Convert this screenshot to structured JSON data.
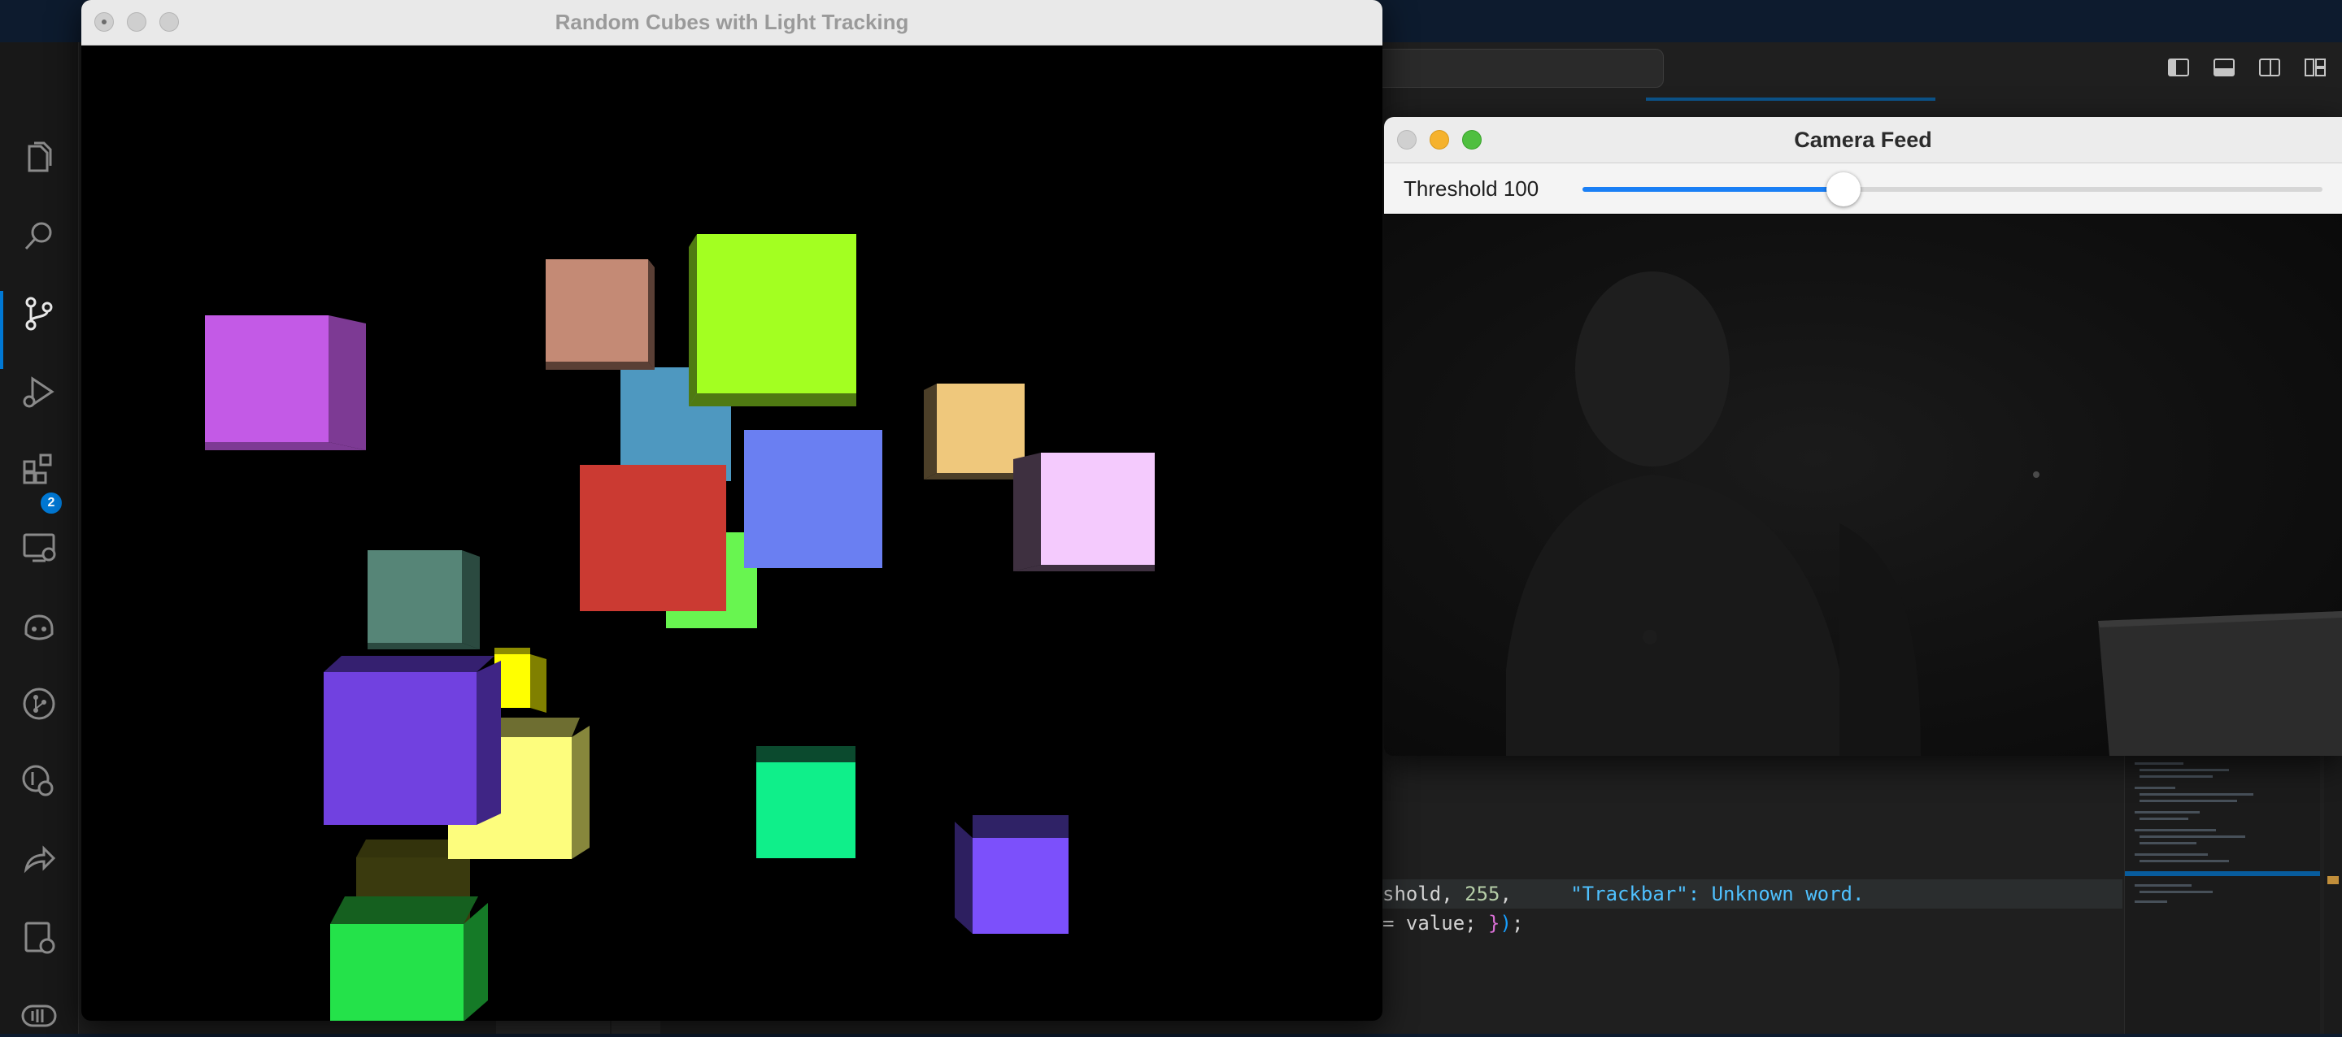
{
  "vscode": {
    "activity_badge": "2",
    "code_lines": [
      {
        "pre": "shold, ",
        "num": "255",
        "post": ",     ",
        "diag": "\"Trackbar\": Unknown word."
      },
      {
        "pre": "= value; ",
        "brace1": "}",
        "brace2": ")",
        "post": ";"
      }
    ]
  },
  "cube_window": {
    "title": "Random Cubes with Light Tracking"
  },
  "camera_window": {
    "title": "Camera Feed",
    "threshold_label": "Threshold 100",
    "slider_value": 100,
    "slider_max": 255
  },
  "icons": [
    "explorer-icon",
    "search-icon",
    "source-control-icon",
    "run-debug-icon",
    "extensions-icon",
    "remote-explorer-icon",
    "copilot-icon",
    "git-graph-icon",
    "git-lens-icon",
    "live-share-icon",
    "settings-sync-icon",
    "accounts-icon"
  ],
  "colors": {
    "accent": "#0078d4",
    "slider_fill": "#1a7ff5",
    "cam_close": "#d0d0d0",
    "cam_minimize": "#f5b22e",
    "cam_zoom": "#4fbf3f"
  },
  "cubes": [
    {
      "name": "magenta",
      "front": "#c35ae6",
      "side": "#7d3a94",
      "topc": "#8e43a8"
    },
    {
      "name": "tan",
      "front": "#c48a75",
      "side": "#5a3f35",
      "topc": "#7a5647"
    },
    {
      "name": "lime",
      "front": "#a3ff21",
      "side": "#4f7a12",
      "topc": "#5e9016"
    },
    {
      "name": "steel-blue",
      "front": "#4e98c0",
      "side": "#2a5670",
      "topc": "#2f607a"
    },
    {
      "name": "peach",
      "front": "#efc87c",
      "side": "#4c3f28",
      "topc": "#6d5a38"
    },
    {
      "name": "cornflower",
      "front": "#6a7ff2",
      "side": "#3a4688",
      "topc": "#3d4a8e"
    },
    {
      "name": "pink",
      "front": "#f4cafd",
      "side": "#3e3040",
      "topc": "#5f4b62"
    },
    {
      "name": "red",
      "front": "#cb3a32",
      "side": "#6b1e1a",
      "topc": "#7a221d"
    },
    {
      "name": "light-green",
      "front": "#68f550",
      "side": "#367d29",
      "topc": "#3c8a2d"
    },
    {
      "name": "sage",
      "front": "#568577",
      "side": "#2b4a40",
      "topc": "#325349"
    },
    {
      "name": "yellow",
      "front": "#ffff00",
      "side": "#808000",
      "topc": "#8c8c00"
    },
    {
      "name": "violet",
      "front": "#7141e0",
      "side": "#3f2585",
      "topc": "#352070"
    },
    {
      "name": "butter",
      "front": "#fdfd7d",
      "side": "#87873c",
      "topc": "#6e6e31"
    },
    {
      "name": "spring-green",
      "front": "#0fef8a",
      "side": "#085a36",
      "topc": "#0b4a2e"
    },
    {
      "name": "purple",
      "front": "#7c50fb",
      "side": "#2d1f60",
      "topc": "#2f2266"
    },
    {
      "name": "green",
      "front": "#24e24a",
      "side": "#157a27",
      "topc": "#15601f"
    },
    {
      "name": "olive",
      "front": "#3a3a0e",
      "side": "#2a2a08",
      "topc": "#33330c"
    }
  ]
}
